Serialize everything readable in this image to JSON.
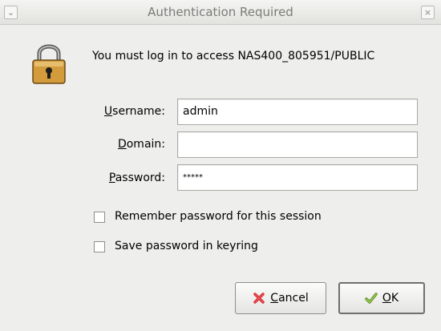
{
  "window": {
    "title": "Authentication Required",
    "menu_glyph": "⌄",
    "close_glyph": "×"
  },
  "icons": {
    "window_menu": "chevron-down-icon",
    "window_close": "close-icon",
    "dialog": "lock-icon",
    "cancel": "x-icon",
    "ok": "checkmark-icon"
  },
  "message": "You must log in to access NAS400_805951/PUBLIC",
  "form": {
    "username": {
      "mnemonic": "U",
      "label_rest": "sername:",
      "value": "admin"
    },
    "domain": {
      "mnemonic": "D",
      "label_rest": "omain:",
      "value": ""
    },
    "password": {
      "mnemonic": "P",
      "label_rest": "assword:",
      "value": "*****"
    }
  },
  "options": {
    "remember_session": {
      "label": "Remember password for this session",
      "checked": false
    },
    "save_keyring": {
      "label": "Save password in keyring",
      "checked": false
    }
  },
  "buttons": {
    "cancel": {
      "mnemonic": "C",
      "label_rest": "ancel"
    },
    "ok": {
      "mnemonic": "O",
      "label_rest": "K"
    }
  },
  "colors": {
    "cancel_icon": "#d8262d",
    "ok_icon": "#9bd34c",
    "lock_body": "#d39b3c"
  }
}
